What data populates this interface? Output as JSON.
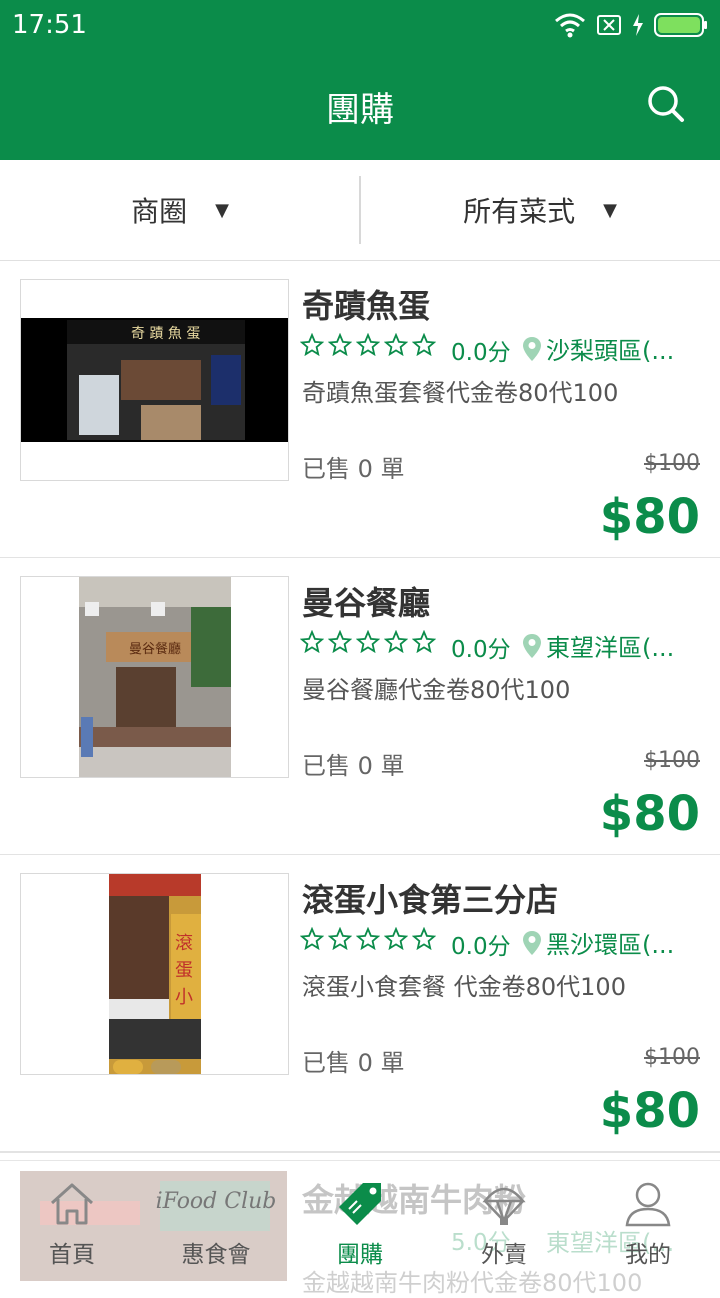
{
  "status_bar": {
    "time": "17:51"
  },
  "header": {
    "title": "團購",
    "search_icon": "search-icon"
  },
  "filters": {
    "area": "商圈",
    "cuisine": "所有菜式"
  },
  "deals": [
    {
      "name": "奇蹟魚蛋",
      "rating": "0.0分",
      "district": "沙梨頭區(...",
      "description": "奇蹟魚蛋套餐代金卷80代100",
      "sold": "已售 0 單",
      "original_price": "$100",
      "price": "$80"
    },
    {
      "name": "曼谷餐廳",
      "rating": "0.0分",
      "district": "東望洋區(...",
      "description": "曼谷餐廳代金卷80代100",
      "sold": "已售 0 單",
      "original_price": "$100",
      "price": "$80"
    },
    {
      "name": "滾蛋小食第三分店",
      "rating": "0.0分",
      "district": "黑沙環區(...",
      "description": "滾蛋小食套餐 代金卷80代100",
      "sold": "已售 0 單",
      "original_price": "$100",
      "price": "$80"
    }
  ],
  "bottom_nav": {
    "items": [
      {
        "label": "首頁",
        "icon": "home-icon"
      },
      {
        "label": "惠食會",
        "icon": "ifood-club-logo"
      },
      {
        "label": "團購",
        "icon": "tag-icon"
      },
      {
        "label": "外賣",
        "icon": "delivery-icon"
      },
      {
        "label": "我的",
        "icon": "user-icon"
      }
    ],
    "active": "團購",
    "brand_text": "iFood Club"
  },
  "peek_deal": {
    "name": "金越越南牛肉粉",
    "rating": "5.0分",
    "district": "東望洋區(...",
    "description": "金越越南牛肉粉代金卷80代100"
  },
  "colors": {
    "brand_green": "#0b8c4a",
    "price_green": "#0b8c4a"
  }
}
